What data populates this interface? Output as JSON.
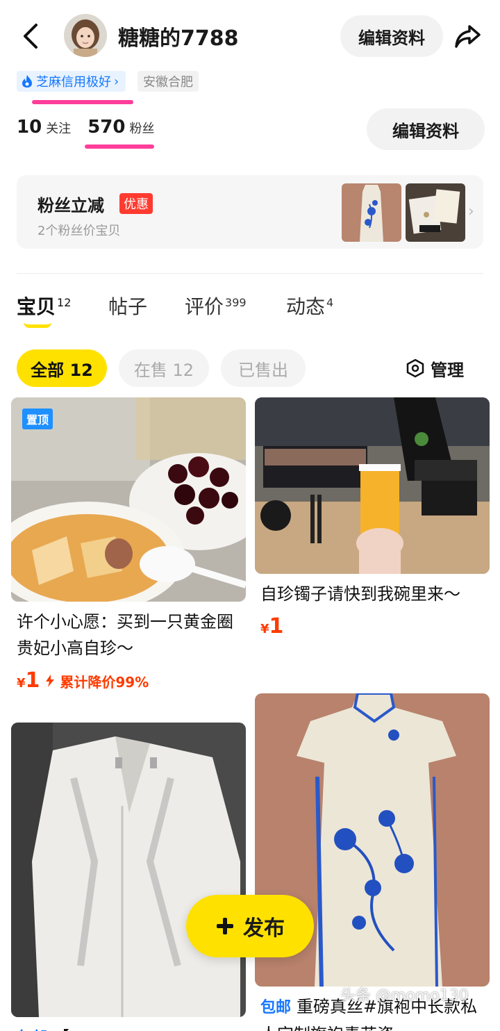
{
  "header": {
    "username": "糖糖的7788",
    "edit_label": "编辑资料"
  },
  "profile": {
    "credit_label": "芝麻信用极好",
    "location": "安徽合肥",
    "following_count": "10",
    "following_label": "关注",
    "fans_count": "570",
    "fans_label": "粉丝",
    "edit_label": "编辑资料"
  },
  "promo": {
    "title": "粉丝立减",
    "badge": "优惠",
    "subtitle": "2个粉丝价宝贝"
  },
  "tabs": [
    {
      "label": "宝贝",
      "count": "12"
    },
    {
      "label": "帖子",
      "count": ""
    },
    {
      "label": "评价",
      "count": "399"
    },
    {
      "label": "动态",
      "count": "4"
    }
  ],
  "filters": {
    "all": "全部 12",
    "on_sale": "在售 12",
    "sold": "已售出",
    "manage": "管理"
  },
  "items": [
    {
      "pin": "置顶",
      "title": "许个小心愿：买到一只黄金圈贵妃小高自珍～",
      "yen": "¥",
      "price": "1",
      "drop": "累计降价99%"
    },
    {
      "title": "自珍镯子请快到我碗里来～",
      "yen": "¥",
      "price": "1"
    },
    {
      "free_ship": "包邮",
      "title": "【..."
    },
    {
      "free_ship": "包邮",
      "title": "重磅真丝#旗袍中长款私人定制旗袍青花瓷"
    }
  ],
  "publish_label": "发布",
  "watermark": "头条 @momo130",
  "colors": {
    "accent_yellow": "#ffe100",
    "price_red": "#ff3b00",
    "credit_blue": "#1677ff",
    "annotation_pink": "#ff3d9a"
  }
}
